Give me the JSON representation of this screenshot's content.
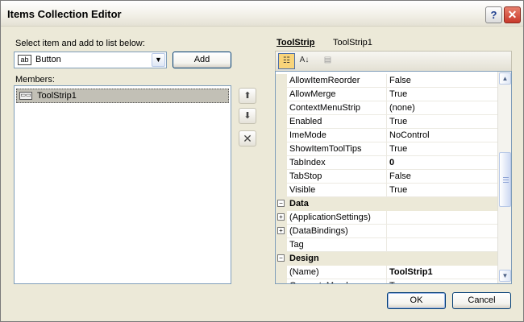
{
  "window": {
    "title": "Items Collection Editor",
    "help_glyph": "?",
    "close_glyph": "✕"
  },
  "left": {
    "select_label": "Select item and add to list below:",
    "combo_icon_text": "ab",
    "combo_value": "Button",
    "add_label": "Add",
    "members_label": "Members:",
    "members": [
      {
        "label": "ToolStrip1",
        "selected": true
      }
    ]
  },
  "properties": {
    "header_type": "ToolStrip",
    "header_name": "ToolStrip1",
    "toolbar": {
      "categorized_icon": "categorized-icon",
      "alphabetical_icon": "alphabetical-icon",
      "property_pages_icon": "property-pages-icon"
    },
    "rows": [
      {
        "kind": "prop",
        "name": "AllowItemReorder",
        "value": "False"
      },
      {
        "kind": "prop",
        "name": "AllowMerge",
        "value": "True"
      },
      {
        "kind": "prop",
        "name": "ContextMenuStrip",
        "value": "(none)"
      },
      {
        "kind": "prop",
        "name": "Enabled",
        "value": "True"
      },
      {
        "kind": "prop",
        "name": "ImeMode",
        "value": "NoControl"
      },
      {
        "kind": "prop",
        "name": "ShowItemToolTips",
        "value": "True"
      },
      {
        "kind": "prop",
        "name": "TabIndex",
        "value": "0",
        "bold": true
      },
      {
        "kind": "prop",
        "name": "TabStop",
        "value": "False"
      },
      {
        "kind": "prop",
        "name": "Visible",
        "value": "True"
      },
      {
        "kind": "cat",
        "name": "Data",
        "expander": "−"
      },
      {
        "kind": "prop",
        "name": "(ApplicationSettings)",
        "value": "",
        "expander": "+"
      },
      {
        "kind": "prop",
        "name": "(DataBindings)",
        "value": "",
        "expander": "+"
      },
      {
        "kind": "prop",
        "name": "Tag",
        "value": ""
      },
      {
        "kind": "cat",
        "name": "Design",
        "expander": "−"
      },
      {
        "kind": "prop",
        "name": "(Name)",
        "value": "ToolStrip1",
        "bold": true
      },
      {
        "kind": "prop",
        "name": "GenerateMember",
        "value": "True"
      }
    ]
  },
  "footer": {
    "ok_label": "OK",
    "cancel_label": "Cancel"
  }
}
